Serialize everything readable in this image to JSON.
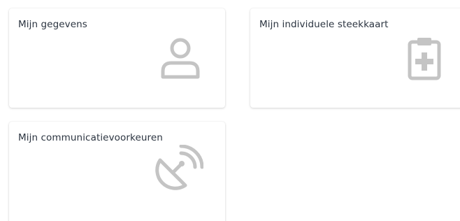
{
  "cards": [
    {
      "title": "Mijn gegevens",
      "icon": "user-icon"
    },
    {
      "title": "Mijn individuele steekkaart",
      "icon": "clipboard-medical-icon"
    },
    {
      "title": "Mijn communicatievoorkeuren",
      "icon": "satellite-dish-icon"
    }
  ],
  "colors": {
    "icon": "#c4c4c4",
    "title": "#2b3440",
    "card_background": "#ffffff"
  }
}
